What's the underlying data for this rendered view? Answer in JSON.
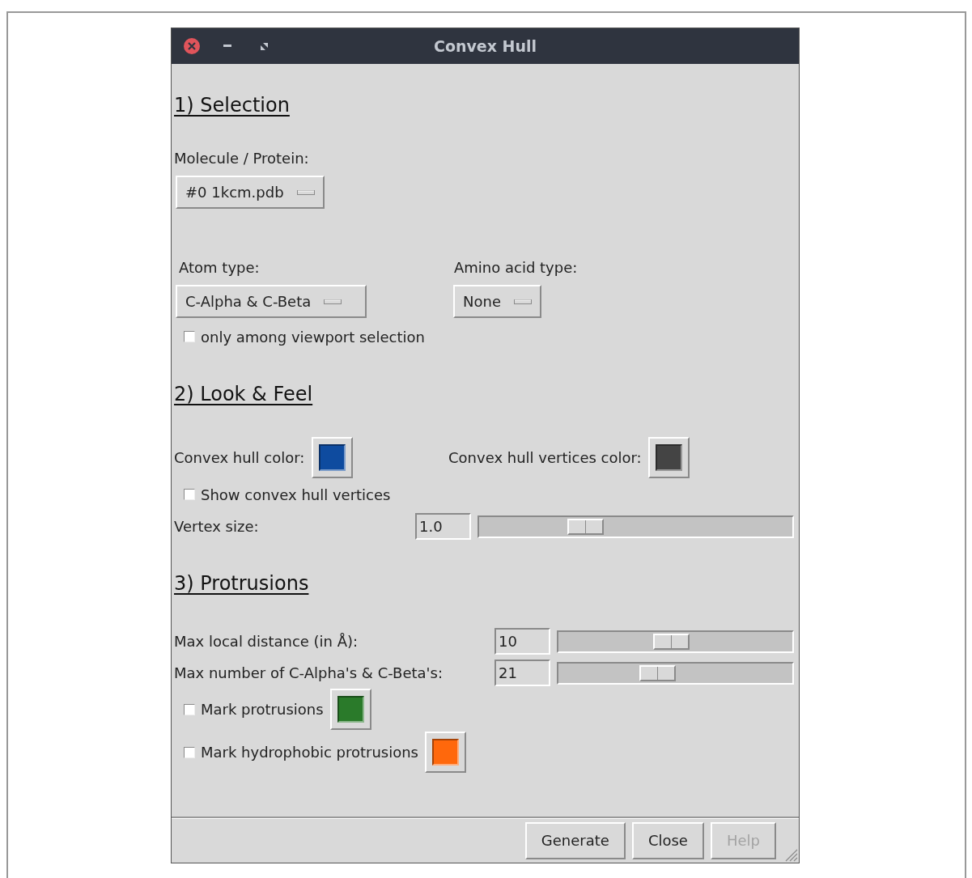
{
  "window": {
    "title": "Convex Hull"
  },
  "selection": {
    "heading": "1) Selection",
    "molecule": {
      "label": "Molecule / Protein:",
      "value": "#0 1kcm.pdb"
    },
    "atom_type": {
      "label": "Atom type:",
      "value": "C-Alpha & C-Beta"
    },
    "amino_acid_type": {
      "label": "Amino acid type:",
      "value": "None"
    },
    "viewport_only": {
      "label": "only among viewport selection",
      "checked": false
    }
  },
  "look_and_feel": {
    "heading": "2) Look & Feel",
    "hull_color": {
      "label": "Convex hull color:",
      "color": "#0e4b9f"
    },
    "vertices_color": {
      "label": "Convex hull vertices color:",
      "color": "#444444"
    },
    "show_vertices": {
      "label": "Show convex hull vertices",
      "checked": false
    },
    "vertex_size": {
      "label": "Vertex size:",
      "value": "1.0",
      "level": 0.32
    }
  },
  "protrusions": {
    "heading": "3) Protrusions",
    "max_local_distance": {
      "label": "Max local distance (in Å):",
      "value": "10",
      "level": 0.48
    },
    "max_number": {
      "label": "Max number of C-Alpha's & C-Beta's:",
      "value": "21",
      "level": 0.41
    },
    "mark_protrusions": {
      "label": "Mark protrusions",
      "checked": false,
      "color": "#2a7a2a"
    },
    "mark_hydrophobic": {
      "label": "Mark hydrophobic protrusions",
      "checked": false,
      "color": "#ff680c"
    }
  },
  "buttons": [
    {
      "label": "Generate",
      "disabled": false
    },
    {
      "label": "Close",
      "disabled": false
    },
    {
      "label": "Help",
      "disabled": true
    }
  ]
}
